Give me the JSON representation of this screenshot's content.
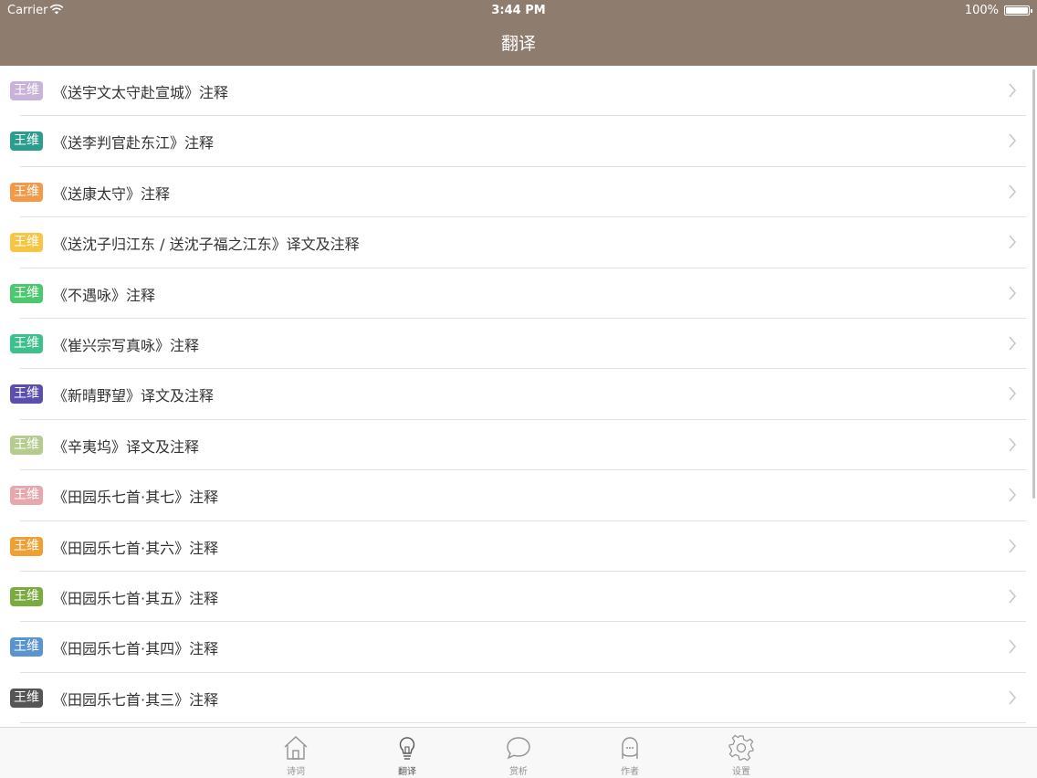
{
  "status_bar": {
    "carrier": "Carrier",
    "time": "3:44 PM",
    "battery": "100%"
  },
  "header": {
    "title": "翻译"
  },
  "list": {
    "items": [
      {
        "badge": "王维",
        "badge_color": "#c9b3d9",
        "title": "《送宇文太守赴宣城》注释"
      },
      {
        "badge": "王维",
        "badge_color": "#2a9d8f",
        "title": "《送李判官赴东江》注释"
      },
      {
        "badge": "王维",
        "badge_color": "#f39a4a",
        "title": "《送康太守》注释"
      },
      {
        "badge": "王维",
        "badge_color": "#f6c544",
        "title": "《送沈子归江东 / 送沈子福之江东》译文及注释"
      },
      {
        "badge": "王维",
        "badge_color": "#4cc96f",
        "title": "《不遇咏》注释"
      },
      {
        "badge": "王维",
        "badge_color": "#3cc18c",
        "title": "《崔兴宗写真咏》注释"
      },
      {
        "badge": "王维",
        "badge_color": "#5a4fb0",
        "title": "《新晴野望》译文及注释"
      },
      {
        "badge": "王维",
        "badge_color": "#b5cc8e",
        "title": "《辛夷坞》译文及注释"
      },
      {
        "badge": "王维",
        "badge_color": "#e6a7ad",
        "title": "《田园乐七首·其七》注释"
      },
      {
        "badge": "王维",
        "badge_color": "#f0a033",
        "title": "《田园乐七首·其六》注释"
      },
      {
        "badge": "王维",
        "badge_color": "#7aab3e",
        "title": "《田园乐七首·其五》注释"
      },
      {
        "badge": "王维",
        "badge_color": "#5a94d0",
        "title": "《田园乐七首·其四》注释"
      },
      {
        "badge": "王维",
        "badge_color": "#555555",
        "title": "《田园乐七首·其三》注释"
      }
    ]
  },
  "tab_bar": {
    "tabs": [
      {
        "label": "诗词",
        "icon": "home-icon"
      },
      {
        "label": "翻译",
        "icon": "lightbulb-icon",
        "active": true
      },
      {
        "label": "赏析",
        "icon": "chat-bubble-icon"
      },
      {
        "label": "作者",
        "icon": "person-face-icon"
      },
      {
        "label": "设置",
        "icon": "gear-icon"
      }
    ]
  }
}
